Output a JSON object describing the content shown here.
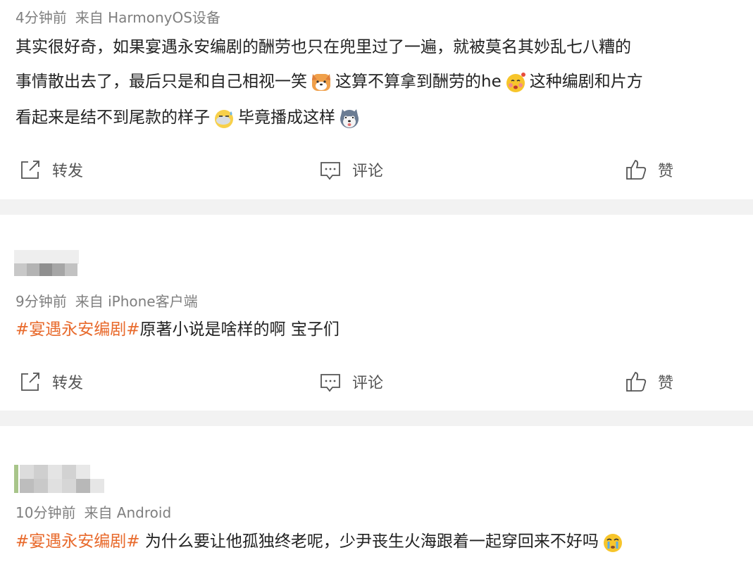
{
  "posts": [
    {
      "meta": {
        "time": "4分钟前",
        "source": "来自 HarmonyOS设备"
      },
      "lines": [
        [
          "其实很好奇，如果宴遇永安编剧的酬劳也只在兜里过了一遍，就被莫名其妙乱七八糟的"
        ],
        [
          "事情散出去了，最后只是和自己相视一笑",
          "这算不算拿到酬劳的he",
          "这种编剧和片方"
        ],
        [
          "看起来是结不到尾款的样子",
          "毕竟播成这样"
        ]
      ],
      "emojis": [
        "dog-face-emoji",
        "tipsy-face-emoji",
        "sweat-face-emoji",
        "husky-face-emoji"
      ]
    },
    {
      "meta": {
        "time": "9分钟前",
        "source": "来自 iPhone客户端"
      },
      "topic": "#宴遇永安编剧#",
      "text": "原著小说是啥样的啊 宝子们"
    },
    {
      "meta": {
        "time": "10分钟前",
        "source": "来自 Android"
      },
      "topic": "#宴遇永安编剧#",
      "text": " 为什么要让他孤独终老呢，少尹丧生火海跟着一起穿回来不好吗",
      "emojis": [
        "crying-face-emoji"
      ]
    }
  ],
  "actions": {
    "repost": "转发",
    "comment": "评论",
    "like": "赞"
  },
  "colors": {
    "topic": "#e86a2c",
    "meta": "#7f7f7f",
    "separator": "#f2f2f2"
  }
}
